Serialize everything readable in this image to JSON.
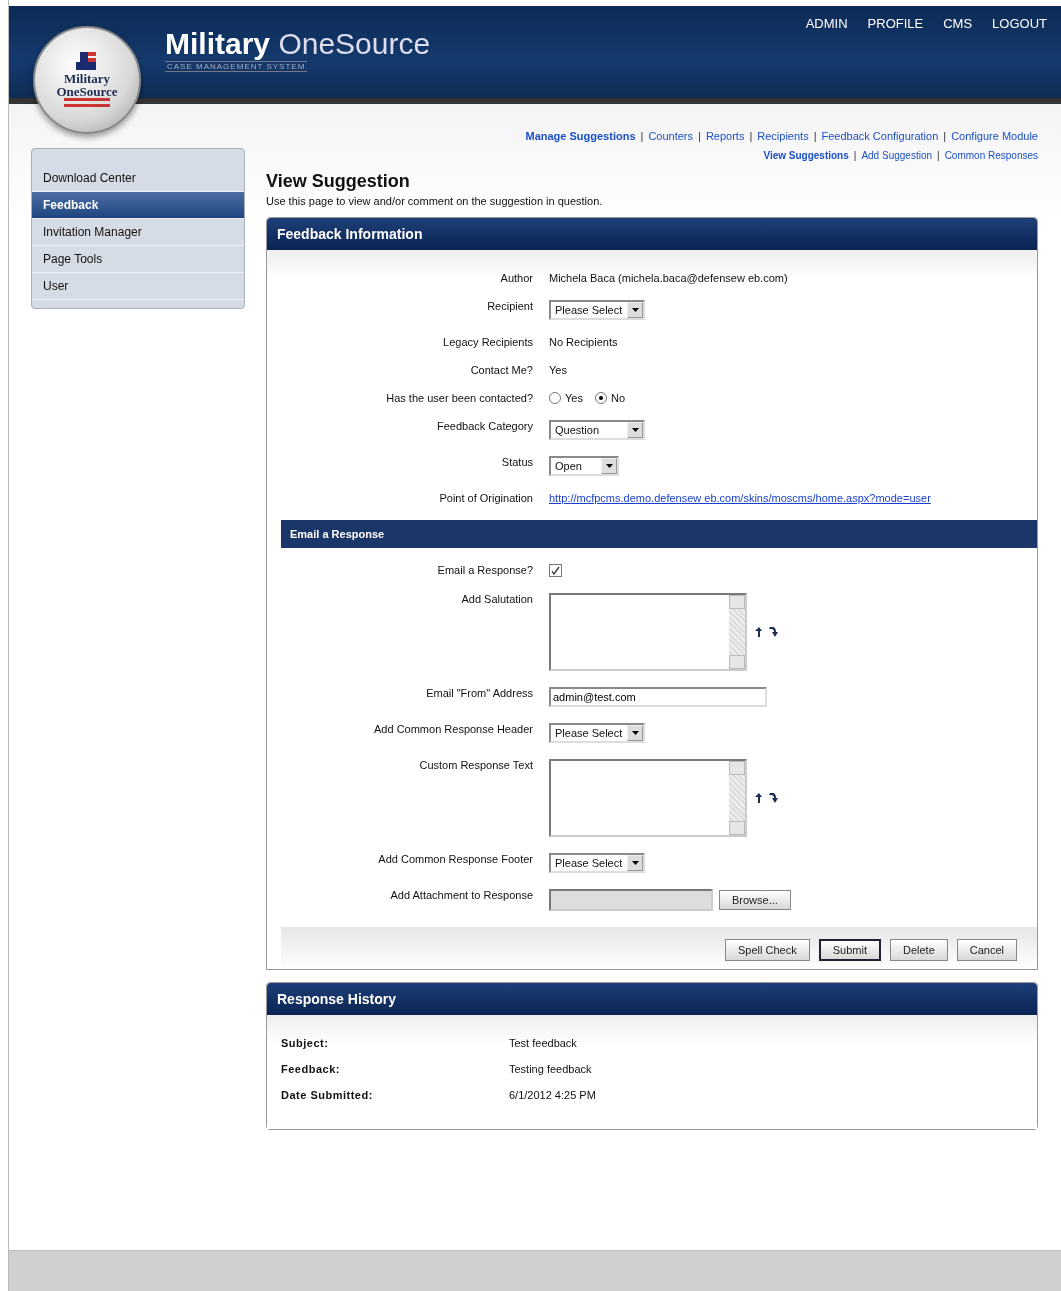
{
  "header": {
    "logo_badge": [
      "Military",
      "OneSource"
    ],
    "brand_bold": "Military",
    "brand_light": "OneSource",
    "brand_subtitle": "CASE MANAGEMENT SYSTEM",
    "top_links": [
      "ADMIN",
      "PROFILE",
      "CMS",
      "LOGOUT"
    ]
  },
  "sidebar": {
    "items": [
      {
        "label": "Download Center",
        "selected": false
      },
      {
        "label": "Feedback",
        "selected": true
      },
      {
        "label": "Invitation Manager",
        "selected": false
      },
      {
        "label": "Page Tools",
        "selected": false
      },
      {
        "label": "User",
        "selected": false
      }
    ]
  },
  "subnav_separator": "|",
  "subnav": [
    {
      "label": "Manage Suggestions",
      "selected": true
    },
    {
      "label": "Counters",
      "selected": false
    },
    {
      "label": "Reports",
      "selected": false
    },
    {
      "label": "Recipients",
      "selected": false
    },
    {
      "label": "Feedback Configuration",
      "selected": false
    },
    {
      "label": "Configure Module",
      "selected": false
    }
  ],
  "subnav_secondary": [
    {
      "label": "View Suggestions",
      "selected": true
    },
    {
      "label": "Add Suggestion",
      "selected": false
    },
    {
      "label": "Common Responses",
      "selected": false
    }
  ],
  "page": {
    "title": "View Suggestion",
    "description": "Use this page to view  and/or comment on the suggestion in question."
  },
  "feedback_panel": {
    "title": "Feedback Information",
    "fields": [
      {
        "kind": "text",
        "label": "Author",
        "value": "Michela Baca (michela.baca@defensew eb.com)"
      },
      {
        "kind": "select",
        "label": "Recipient",
        "value": "Please Select"
      },
      {
        "kind": "text",
        "label": "Legacy Recipients",
        "value": "No Recipients"
      },
      {
        "kind": "text",
        "label": "Contact Me?",
        "value": "Yes"
      },
      {
        "kind": "radio",
        "label": "Has the user been contacted?",
        "options": [
          {
            "label": "Yes",
            "selected": false
          },
          {
            "label": "No",
            "selected": true
          }
        ]
      },
      {
        "kind": "select",
        "label": "Feedback Category",
        "value": "Question"
      },
      {
        "kind": "select",
        "label": "Status",
        "value": "Open"
      },
      {
        "kind": "link",
        "label": "Point of Origination",
        "value": "http://mcfpcms.demo.defensew eb.com/skins/moscms/home.aspx?mode=user"
      }
    ],
    "section_title": "Email a Response",
    "response_fields": [
      {
        "kind": "checkbox",
        "label": "Email a Response?",
        "checked": true
      },
      {
        "kind": "textarea",
        "label": "Add Salutation"
      },
      {
        "kind": "input",
        "label": "Email \"From\" Address",
        "value": "admin@test.com"
      },
      {
        "kind": "select",
        "label": "Add Common Response Header",
        "value": "Please Select"
      },
      {
        "kind": "textarea",
        "label": "Custom Response Text"
      },
      {
        "kind": "select",
        "label": "Add Common Response Footer",
        "value": "Please Select"
      },
      {
        "kind": "file",
        "label": "Add Attachment to Response",
        "button": "Browse..."
      }
    ],
    "buttons": [
      {
        "label": "Spell Check",
        "default": false
      },
      {
        "label": "Submit",
        "default": true
      },
      {
        "label": "Delete",
        "default": false
      },
      {
        "label": "Cancel",
        "default": false
      }
    ]
  },
  "history_panel": {
    "title": "Response History",
    "rows": [
      {
        "label": "Subject:",
        "value": "Test feedback"
      },
      {
        "label": "Feedback:",
        "value": "Testing feedback"
      },
      {
        "label": "Date Submitted:",
        "value": "6/1/2012 4:25 PM"
      }
    ]
  }
}
